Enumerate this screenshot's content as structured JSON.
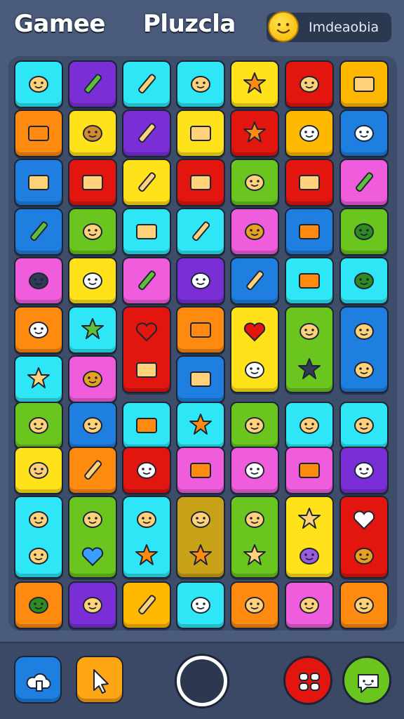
{
  "header": {
    "title_left": "Gamee",
    "title_center": "Pluzcla",
    "profile_name": "Imdeaobia",
    "avatar_icon": "smiley-face-icon"
  },
  "colors": {
    "background": "#4a5b7b",
    "cyan": "#2ee6f6",
    "purple": "#7a2ed6",
    "yellow": "#ffe21a",
    "red": "#e3150f",
    "orange": "#ff8a10",
    "blue": "#1f7fe0",
    "green": "#6bc51f",
    "pink": "#f05ddc",
    "amber": "#ffb800",
    "olive": "#c8a319"
  },
  "tiles": [
    {
      "color": "cyan",
      "icon": "pumpkin-face-icon"
    },
    {
      "color": "purple",
      "icon": "pencil-crossed-icon"
    },
    {
      "color": "cyan",
      "icon": "paintbrush-icon"
    },
    {
      "color": "cyan",
      "icon": "fox-face-icon"
    },
    {
      "color": "yellow",
      "icon": "sun-face-icon"
    },
    {
      "color": "red",
      "icon": "robot-icon"
    },
    {
      "color": "amber",
      "icon": "calendar-icon"
    },
    {
      "color": "orange",
      "icon": "laptop-icon"
    },
    {
      "color": "yellow",
      "icon": "bear-face-icon"
    },
    {
      "color": "purple",
      "icon": "marker-icon"
    },
    {
      "color": "yellow",
      "icon": "printer-icon"
    },
    {
      "color": "red",
      "icon": "gear-sun-icon"
    },
    {
      "color": "amber",
      "icon": "cloud-face-icon"
    },
    {
      "color": "blue",
      "icon": "leaf-bubble-icon"
    },
    {
      "color": "blue",
      "icon": "radio-icon"
    },
    {
      "color": "red",
      "icon": "box-icon"
    },
    {
      "color": "yellow",
      "icon": "capsule-icon"
    },
    {
      "color": "red",
      "icon": "cash-register-icon"
    },
    {
      "color": "green",
      "icon": "car-front-icon"
    },
    {
      "color": "red",
      "icon": "control-panel-icon"
    },
    {
      "color": "pink",
      "icon": "pencil-icon"
    },
    {
      "color": "blue",
      "icon": "green-pen-icon"
    },
    {
      "color": "green",
      "icon": "drop-face-icon"
    },
    {
      "color": "cyan",
      "icon": "keypad-icon"
    },
    {
      "color": "cyan",
      "icon": "crayon-icon"
    },
    {
      "color": "pink",
      "icon": "cat-face-icon"
    },
    {
      "color": "blue",
      "icon": "tablet-icon"
    },
    {
      "color": "green",
      "icon": "rocket-leaf-icon"
    },
    {
      "color": "pink",
      "icon": "bear-dark-icon"
    },
    {
      "color": "yellow",
      "icon": "chat-bubble-icon"
    },
    {
      "color": "pink",
      "icon": "pen-paper-icon"
    },
    {
      "color": "purple",
      "icon": "speech-bubble-icon"
    },
    {
      "color": "blue",
      "icon": "brush-icon"
    },
    {
      "color": "cyan",
      "icon": "screen-icon"
    },
    {
      "color": "cyan",
      "icon": "flame-leaf-icon"
    }
  ],
  "tiles_lower": [
    {
      "color": "orange",
      "icon": "cloud-blob-icon"
    },
    {
      "color": "cyan",
      "icon": "gear-green-icon"
    },
    {
      "color": "red",
      "icon": "heart-icon",
      "icon2": "tray-icon",
      "tall": true
    },
    {
      "color": "orange",
      "icon": "monitor-icon"
    },
    {
      "color": "yellow",
      "icon": "heart-face-icon",
      "icon2": "cloud-face-icon",
      "tall": true
    },
    {
      "color": "green",
      "icon": "bus-icon",
      "icon2": "gear-dark-icon",
      "tall": true
    },
    {
      "color": "blue",
      "icon": "tiger-face-icon",
      "icon2": "dog-face-icon",
      "tall": true
    },
    {
      "color": "cyan",
      "icon": "starfish-icon"
    },
    {
      "color": "pink",
      "icon": "cat-yellow-icon"
    },
    {
      "color": "blue",
      "icon": "envelope-icon"
    }
  ],
  "tiles_row8": [
    {
      "color": "green",
      "icon": "trash-can-icon"
    },
    {
      "color": "blue",
      "icon": "cookie-icon"
    },
    {
      "color": "cyan",
      "icon": "window-icon"
    },
    {
      "color": "cyan",
      "icon": "blob-sun-icon"
    },
    {
      "color": "green",
      "icon": "chili-icon"
    },
    {
      "color": "cyan",
      "icon": "lemon-icon"
    },
    {
      "color": "cyan",
      "icon": "tomato-face-icon"
    }
  ],
  "tiles_row9": [
    {
      "color": "yellow",
      "icon": "radish-icon"
    },
    {
      "color": "orange",
      "icon": "feather-icon"
    },
    {
      "color": "red",
      "icon": "ghost-chat-icon"
    },
    {
      "color": "pink",
      "icon": "card-icon"
    },
    {
      "color": "pink",
      "icon": "cloud-smile-icon"
    },
    {
      "color": "pink",
      "icon": "tv-icon"
    },
    {
      "color": "purple",
      "icon": "bubble-face-icon"
    }
  ],
  "tiles_row10": [
    {
      "color": "cyan",
      "icon": "shield-icon",
      "icon2": "eggplant-icon",
      "tall": true
    },
    {
      "color": "green",
      "icon": "kitten-icon",
      "icon2": "heart-blue-icon",
      "tall": true
    },
    {
      "color": "cyan",
      "icon": "bag-icon",
      "icon2": "sun-yellow-icon",
      "tall": true
    },
    {
      "color": "olive",
      "icon": "coin-face-icon",
      "icon2": "sun-small-icon",
      "tall": true
    },
    {
      "color": "green",
      "icon": "treasure-icon",
      "icon2": "star-icon",
      "tall": true
    },
    {
      "color": "yellow",
      "icon": "star-face-icon",
      "icon2": "purple-cat-icon",
      "tall": true
    },
    {
      "color": "red",
      "icon": "heart-white-icon",
      "icon2": "cat-gold-icon",
      "tall": true
    }
  ],
  "tiles_row12": [
    {
      "color": "orange",
      "icon": "leaf-icon"
    },
    {
      "color": "purple",
      "icon": "lion-face-icon"
    },
    {
      "color": "amber",
      "icon": "knife-icon"
    },
    {
      "color": "cyan",
      "icon": "cheese-bubble-icon"
    },
    {
      "color": "orange",
      "icon": "bread-face-icon"
    },
    {
      "color": "pink",
      "icon": "car-icon"
    },
    {
      "color": "orange",
      "icon": "planet-icon"
    }
  ],
  "bottom": {
    "left1_icon": "cloud-upload-icon",
    "left2_icon": "cursor-arrow-icon",
    "center_icon": "circle-button-icon",
    "right1_icon": "gamepad-icon",
    "right2_icon": "chat-icon"
  }
}
